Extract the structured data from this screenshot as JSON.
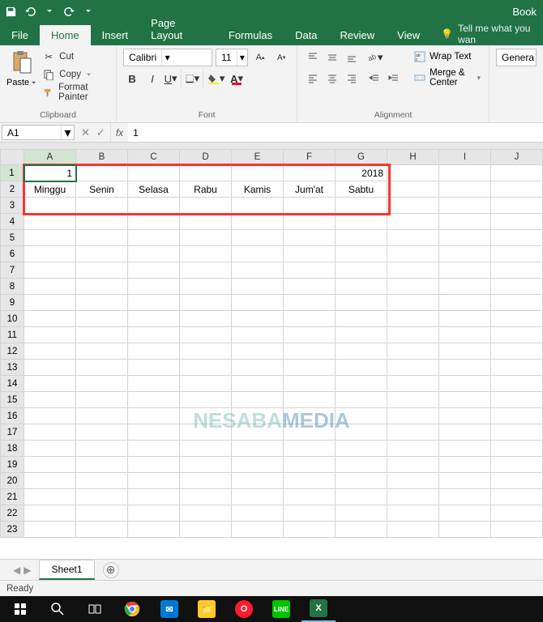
{
  "title": "Book",
  "qat": {
    "save": "save-icon",
    "undo": "undo-icon",
    "redo": "redo-icon"
  },
  "tabs": [
    "File",
    "Home",
    "Insert",
    "Page Layout",
    "Formulas",
    "Data",
    "Review",
    "View"
  ],
  "active_tab": "Home",
  "tell_me": "Tell me what you wan",
  "clipboard": {
    "cut": "Cut",
    "copy": "Copy",
    "format_painter": "Format Painter",
    "paste": "Paste",
    "group": "Clipboard"
  },
  "font": {
    "name": "Calibri",
    "size": "11",
    "group": "Font"
  },
  "alignment": {
    "wrap": "Wrap Text",
    "merge": "Merge & Center",
    "group": "Alignment"
  },
  "number_format": "Genera",
  "namebox": "A1",
  "formula": "1",
  "columns": [
    "A",
    "B",
    "C",
    "D",
    "E",
    "F",
    "G",
    "H",
    "I",
    "J"
  ],
  "num_rows": 23,
  "cells": {
    "A1": "1",
    "G1": "2018",
    "A2": "Minggu",
    "B2": "Senin",
    "C2": "Selasa",
    "D2": "Rabu",
    "E2": "Kamis",
    "F2": "Jum'at",
    "G2": "Sabtu"
  },
  "active_cell": "A1",
  "sheet": "Sheet1",
  "status": "Ready",
  "watermark": {
    "a": "NESABA",
    "b": "MEDIA"
  }
}
